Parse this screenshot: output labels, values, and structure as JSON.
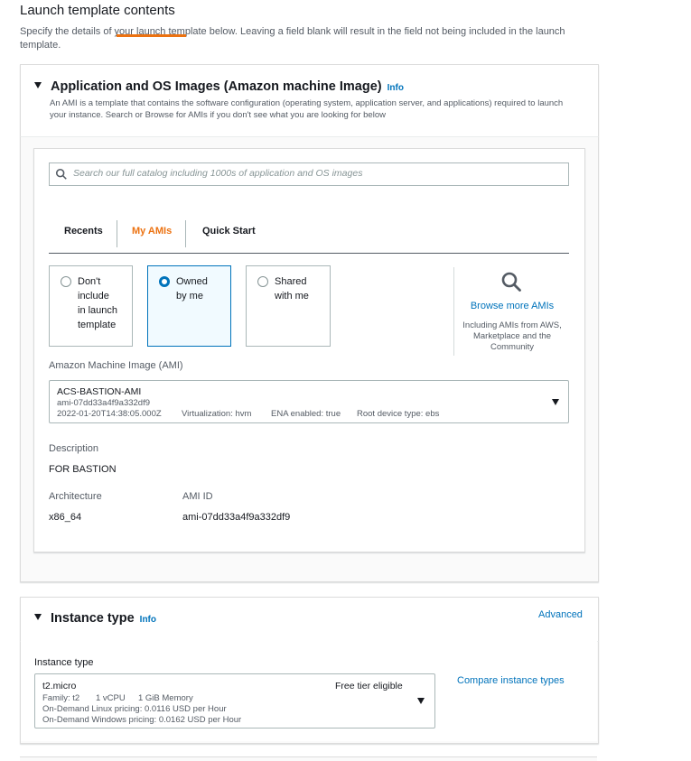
{
  "page": {
    "heading": "Launch template contents",
    "description": "Specify the details of your launch template below. Leaving a field blank will result in the field not being included in the launch template."
  },
  "ami_section": {
    "title": "Application and OS Images (Amazon machine Image)",
    "info": "Info",
    "description": "An AMI is a template that contains the software configuration (operating system, application server, and applications) required to launch your instance. Search or Browse for AMIs if you don't see what you are looking for below",
    "search": {
      "placeholder": "Search our full catalog including 1000s of application and OS images"
    },
    "tabs": [
      {
        "label": "Recents",
        "active": false
      },
      {
        "label": "My AMIs",
        "active": true
      },
      {
        "label": "Quick Start",
        "active": false
      }
    ],
    "source_options": [
      {
        "label": "Don't\ninclude\nin launch\ntemplate",
        "selected": false
      },
      {
        "label": "Owned\nby me",
        "selected": true
      },
      {
        "label": "Shared\nwith me",
        "selected": false
      }
    ],
    "browse": {
      "label": "Browse more AMIs",
      "description": "Including AMIs from AWS, Marketplace and the Community"
    },
    "ami_field": {
      "label": "Amazon Machine Image (AMI)",
      "name": "ACS-BASTION-AMI",
      "id": "ami-07dd33a4f9a332df9",
      "date": "2022-01-20T14:38:05.000Z",
      "virtualization": "Virtualization: hvm",
      "ena": "ENA enabled: true",
      "root_device": "Root device type: ebs"
    },
    "details": {
      "description_label": "Description",
      "description_value": "FOR BASTION",
      "architecture_label": "Architecture",
      "architecture_value": "x86_64",
      "ami_id_label": "AMI ID",
      "ami_id_value": "ami-07dd33a4f9a332df9"
    }
  },
  "instance_section": {
    "title": "Instance type",
    "info": "Info",
    "advanced": "Advanced",
    "field_label": "Instance type",
    "selected": {
      "name": "t2.micro",
      "badge": "Free tier eligible",
      "family": "Family: t2",
      "vcpu": "1 vCPU",
      "memory": "1 GiB Memory",
      "linux_pricing": "On-Demand Linux pricing: 0.0116 USD per Hour",
      "windows_pricing": "On-Demand Windows pricing: 0.0162 USD per Hour"
    },
    "compare_link": "Compare instance types"
  },
  "icons": [
    "search-icon",
    "magnifier-icon",
    "caret-down-icon",
    "select-caret-icon"
  ],
  "colors": {
    "accent": "#ec7211",
    "link": "#0073bb",
    "selected_tile_bg": "#f1faff"
  }
}
